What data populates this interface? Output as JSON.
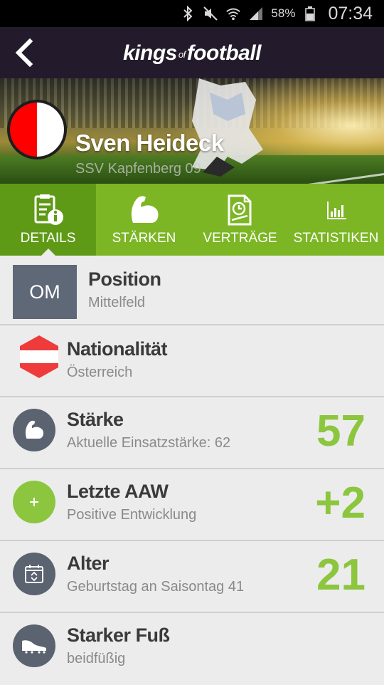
{
  "status": {
    "icons": [
      "bluetooth-icon",
      "mute-icon",
      "wifi-icon",
      "signal-icon",
      "battery-icon"
    ],
    "battery": "58%",
    "time": "07:34"
  },
  "appbar": {
    "logo_a": "kings",
    "logo_of": "of",
    "logo_b": "football"
  },
  "player": {
    "name": "Sven Heideck",
    "club": "SSV Kapfenberg 09",
    "badge_colors": [
      "#ff0000",
      "#ffffff"
    ]
  },
  "tabs": [
    {
      "label": "DETAILS",
      "icon": "document-info-icon",
      "active": true
    },
    {
      "label": "STÄRKEN",
      "icon": "biceps-icon",
      "active": false
    },
    {
      "label": "VERTRÄGE",
      "icon": "contract-icon",
      "active": false
    },
    {
      "label": "STATISTIKEN",
      "icon": "bar-chart-icon",
      "active": false
    }
  ],
  "details": [
    {
      "title": "Position",
      "sub": "Mittelfeld",
      "tag": "OM"
    },
    {
      "title": "Nationalität",
      "sub": "Österreich",
      "icon": "austria-flag-icon"
    },
    {
      "title": "Stärke",
      "sub": "Aktuelle Einsatzstärke: 62",
      "value": "57",
      "icon": "biceps-icon"
    },
    {
      "title": "Letzte AAW",
      "sub": "Positive Entwicklung",
      "value": "+2",
      "icon": "plus-icon"
    },
    {
      "title": "Alter",
      "sub": "Geburtstag an Saisontag 41",
      "value": "21",
      "icon": "calendar-icon"
    },
    {
      "title": "Starker Fuß",
      "sub": "beidfüßig",
      "icon": "football-boot-icon"
    }
  ],
  "colors": {
    "accent_green": "#8cc63f",
    "tab_bar": "#7cb624",
    "tab_active": "#5f9a17",
    "appbar": "#231b2b",
    "icon_circle": "#5b6270"
  }
}
